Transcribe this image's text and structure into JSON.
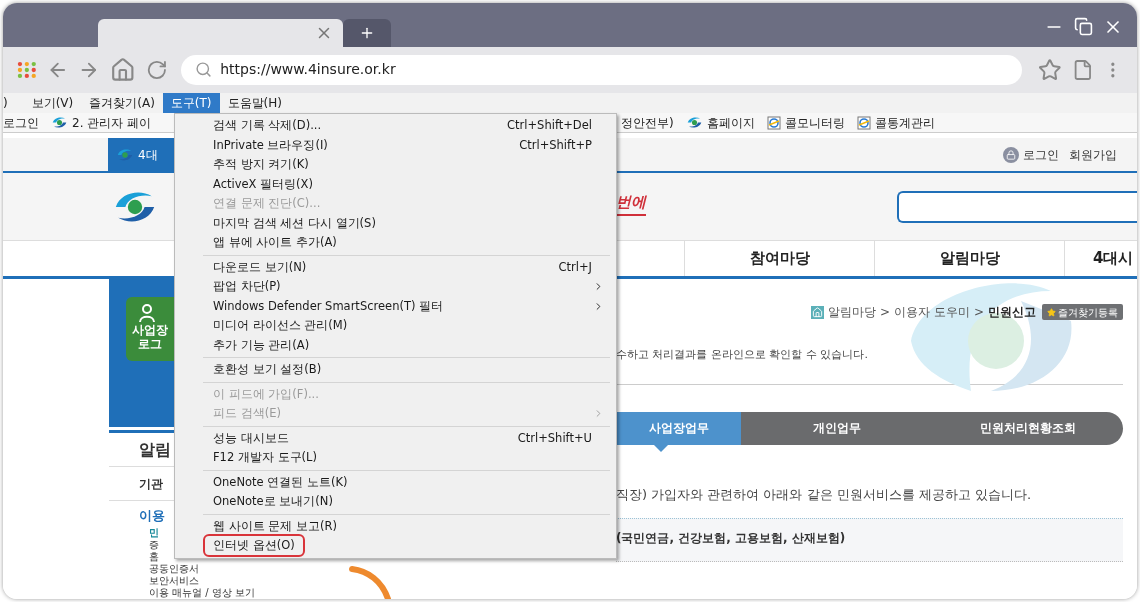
{
  "browser": {
    "address": "https://www.4insure.or.kr"
  },
  "menu_bar": [
    {
      "label": ")",
      "selected": false
    },
    {
      "label": "보기(V)",
      "selected": false
    },
    {
      "label": "즐겨찾기(A)",
      "selected": false
    },
    {
      "label": "도구(T)",
      "selected": true
    },
    {
      "label": "도움말(H)",
      "selected": false
    }
  ],
  "favorites": [
    {
      "label": "로그인",
      "kind": "none"
    },
    {
      "label": "2. 관리자 페이",
      "kind": "site"
    },
    {
      "label": "정안전부)",
      "kind": "none"
    },
    {
      "label": "홈페이지",
      "kind": "site"
    },
    {
      "label": "콜모니터링",
      "kind": "ie"
    },
    {
      "label": "콜통계관리",
      "kind": "ie"
    }
  ],
  "tools_menu": [
    {
      "kind": "item",
      "label": "검색 기록 삭제(D)...",
      "shortcut": "Ctrl+Shift+Del",
      "disabled": false,
      "submenu": false,
      "highlighted": false
    },
    {
      "kind": "item",
      "label": "InPrivate 브라우징(I)",
      "shortcut": "Ctrl+Shift+P",
      "disabled": false,
      "submenu": false,
      "highlighted": false
    },
    {
      "kind": "item",
      "label": "추적 방지 켜기(K)",
      "disabled": false,
      "submenu": false,
      "highlighted": false
    },
    {
      "kind": "item",
      "label": "ActiveX 필터링(X)",
      "disabled": false,
      "submenu": false,
      "highlighted": false
    },
    {
      "kind": "item",
      "label": "연결 문제 진단(C)...",
      "disabled": true,
      "submenu": false,
      "highlighted": false
    },
    {
      "kind": "item",
      "label": "마지막 검색 세션 다시 열기(S)",
      "disabled": false,
      "submenu": false,
      "highlighted": false
    },
    {
      "kind": "item",
      "label": "앱 뷰에 사이트 추가(A)",
      "disabled": false,
      "submenu": false,
      "highlighted": false
    },
    {
      "kind": "separator"
    },
    {
      "kind": "item",
      "label": "다운로드 보기(N)",
      "shortcut": "Ctrl+J",
      "disabled": false,
      "submenu": false,
      "highlighted": false
    },
    {
      "kind": "item",
      "label": "팝업 차단(P)",
      "disabled": false,
      "submenu": true,
      "highlighted": false
    },
    {
      "kind": "item",
      "label": "Windows Defender SmartScreen(T) 필터",
      "disabled": false,
      "submenu": true,
      "highlighted": false
    },
    {
      "kind": "item",
      "label": "미디어 라이선스 관리(M)",
      "disabled": false,
      "submenu": false,
      "highlighted": false
    },
    {
      "kind": "item",
      "label": "추가 기능 관리(A)",
      "disabled": false,
      "submenu": false,
      "highlighted": false
    },
    {
      "kind": "separator"
    },
    {
      "kind": "item",
      "label": "호환성 보기 설정(B)",
      "disabled": false,
      "submenu": false,
      "highlighted": false
    },
    {
      "kind": "separator"
    },
    {
      "kind": "item",
      "label": "이 피드에 가입(F)...",
      "disabled": true,
      "submenu": false,
      "highlighted": false
    },
    {
      "kind": "item",
      "label": "피드 검색(E)",
      "disabled": true,
      "submenu": true,
      "highlighted": false
    },
    {
      "kind": "separator"
    },
    {
      "kind": "item",
      "label": "성능 대시보드",
      "shortcut": "Ctrl+Shift+U",
      "disabled": false,
      "submenu": false,
      "highlighted": false
    },
    {
      "kind": "item",
      "label": "F12 개발자 도구(L)",
      "disabled": false,
      "submenu": false,
      "highlighted": false
    },
    {
      "kind": "separator"
    },
    {
      "kind": "item",
      "label": "OneNote 연결된 노트(K)",
      "disabled": false,
      "submenu": false,
      "highlighted": false
    },
    {
      "kind": "item",
      "label": "OneNote로 보내기(N)",
      "disabled": false,
      "submenu": false,
      "highlighted": false
    },
    {
      "kind": "separator"
    },
    {
      "kind": "item",
      "label": "웹 사이트 문제 보고(R)",
      "disabled": false,
      "submenu": false,
      "highlighted": false
    },
    {
      "kind": "item",
      "label": "인터넷 옵션(O)",
      "disabled": false,
      "submenu": false,
      "highlighted": true
    }
  ],
  "page": {
    "top_badge": "4대",
    "top_links": [
      {
        "label": "로그인",
        "kind": "lock"
      },
      {
        "label": "회원가입",
        "kind": "none"
      }
    ],
    "slogan": "번에",
    "nav": [
      "참여마당",
      "알림마당",
      "4대시"
    ],
    "login_button": [
      "사업장",
      "로그"
    ],
    "sidebar": {
      "title": "알림",
      "section": "기관",
      "subtitle": "이용",
      "links": [
        {
          "label": "민",
          "selected": true
        },
        {
          "label": "증",
          "selected": false
        },
        {
          "label": "홈",
          "selected": false
        },
        {
          "label": "공동인증서",
          "selected": false
        },
        {
          "label": "보안서비스",
          "selected": false
        },
        {
          "label": "이용 매뉴얼 / 영상 보기",
          "selected": false
        }
      ]
    },
    "breadcrumb": {
      "items": [
        "알림마당",
        "이용자 도우미",
        "민원신고"
      ],
      "separator": ">"
    },
    "bookmark_button": "즐겨찾기등록",
    "intro": "수하고 처리결과를 온라인으로 확인할 수 있습니다.",
    "tabs": [
      {
        "label": "사업장업무",
        "selected": true
      },
      {
        "label": "개인업무",
        "selected": false
      },
      {
        "label": "민원처리현황조회",
        "selected": false
      }
    ],
    "description": "직장) 가입자와 관련하여 아래와 같은 민원서비스를 제공하고 있습니다.",
    "insurance_note": "(국민연금, 건강보험, 고용보험, 산재보험)"
  }
}
